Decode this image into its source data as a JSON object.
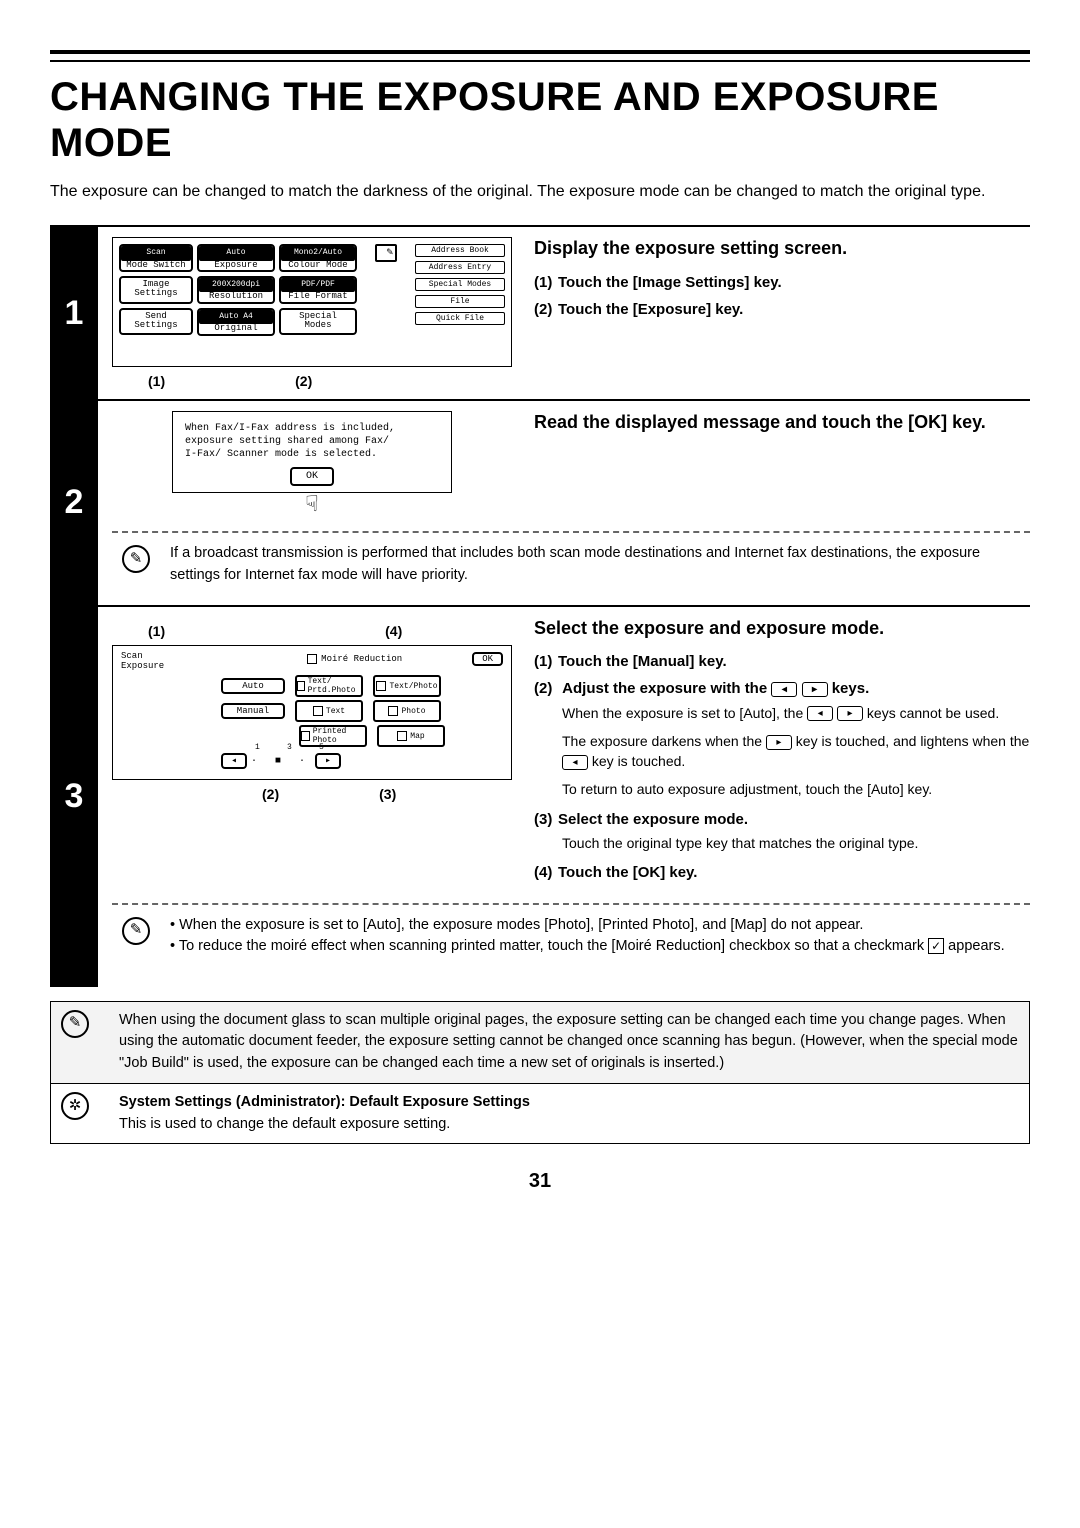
{
  "title": "CHANGING THE EXPOSURE AND EXPOSURE MODE",
  "intro": "The exposure can be changed to match the darkness of the original. The exposure mode can be changed to match the original type.",
  "page_number": "31",
  "step1": {
    "num": "1",
    "heading": "Display the exposure setting screen.",
    "sub1_num": "(1)",
    "sub1": "Touch the [Image Settings] key.",
    "sub2_num": "(2)",
    "sub2": "Touch the [Exposure] key.",
    "callout1": "(1)",
    "callout2": "(2)",
    "screen": {
      "scan": "Scan",
      "mode_switch": "Mode Switch",
      "image_settings": "Image\nSettings",
      "send_settings": "Send Settings",
      "exposure": "Exposure",
      "auto": "Auto",
      "resolution": "Resolution",
      "res_val": "200X200dpi",
      "original": "Original",
      "orig_val": "Auto   A4",
      "colour_mode": "Colour Mode",
      "colour_val": "Mono2/Auto",
      "file_format": "File Format",
      "ff_val": "PDF/PDF",
      "special_modes": "Special Modes",
      "address_book": "Address Book",
      "address_entry": "Address Entry",
      "special_modes2": "Special Modes",
      "file": "File",
      "quick_file": "Quick File"
    }
  },
  "step2": {
    "num": "2",
    "heading": "Read the displayed message and touch the [OK] key.",
    "msg_l1": "When Fax/I-Fax address is included,",
    "msg_l2": "exposure setting shared among Fax/",
    "msg_l3": "I-Fax/ Scanner mode is selected.",
    "ok": "OK",
    "note": "If a broadcast transmission is performed that includes both scan mode destinations and Internet fax destinations, the exposure settings for Internet fax mode will have priority."
  },
  "step3": {
    "num": "3",
    "heading": "Select the exposure and exposure mode.",
    "callout1": "(1)",
    "callout2": "(2)",
    "callout3": "(3)",
    "callout4": "(4)",
    "s1_num": "(1)",
    "s1": "Touch the [Manual] key.",
    "s2_num": "(2)",
    "s2_a": "Adjust the exposure with the ",
    "s2_b": " keys.",
    "s2_note1a": "When the exposure is set to [Auto], the ",
    "s2_note1b": " keys cannot be used.",
    "s2_note2a": "The exposure darkens when the ",
    "s2_note2b": " key is touched, and lightens when the ",
    "s2_note2c": " key is touched.",
    "s2_note3": "To return to auto exposure adjustment, touch the [Auto] key.",
    "s3_num": "(3)",
    "s3": "Select the exposure mode.",
    "s3_note": "Touch the original type key that matches the original type.",
    "s4_num": "(4)",
    "s4": "Touch the [OK] key.",
    "bullet1": "When the exposure is set to [Auto], the exposure modes [Photo], [Printed Photo], and [Map] do not appear.",
    "bullet2a": "To reduce the moiré effect when scanning printed matter, touch the [Moiré Reduction] checkbox so that a checkmark ",
    "bullet2b": " appears.",
    "screen": {
      "scan": "Scan",
      "exposure": "Exposure",
      "moire": "Moiré Reduction",
      "ok": "OK",
      "auto": "Auto",
      "manual": "Manual",
      "mode_text_prtd": "Text/\nPrtd.Photo",
      "mode_text_photo": "Text/Photo",
      "mode_text": "Text",
      "mode_photo": "Photo",
      "mode_printed": "Printed\nPhoto",
      "mode_map": "Map",
      "scale_1": "1",
      "scale_3": "3",
      "scale_5": "5"
    }
  },
  "note_box1": "When using the document glass to scan multiple original pages, the exposure setting can be changed each time you change pages. When using the automatic document feeder, the exposure setting cannot be changed once scanning has begun. (However, when the special mode \"Job Build\" is used, the exposure can be changed each time a new set of originals is inserted.)",
  "note_box2_title": "System Settings (Administrator): Default Exposure Settings",
  "note_box2_body": "This is used to change the default exposure setting."
}
